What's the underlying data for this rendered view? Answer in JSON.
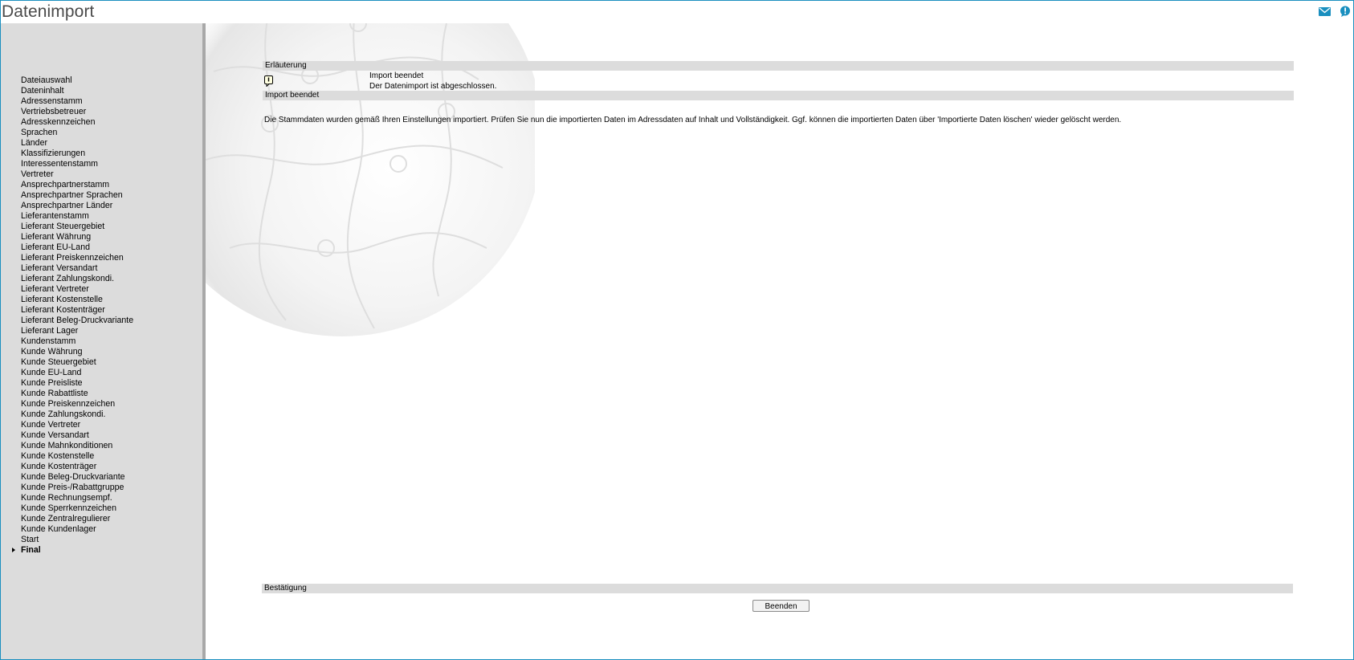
{
  "app": {
    "title": "Datenimport",
    "icons": {
      "mail": "mail-icon",
      "help": "help-icon"
    },
    "accent_color": "#1a8fbf"
  },
  "sidebar": {
    "items": [
      {
        "label": "Dateiauswahl"
      },
      {
        "label": "Dateninhalt"
      },
      {
        "label": "Adressenstamm"
      },
      {
        "label": "Vertriebsbetreuer"
      },
      {
        "label": "Adresskennzeichen"
      },
      {
        "label": "Sprachen"
      },
      {
        "label": "Länder"
      },
      {
        "label": "Klassifizierungen"
      },
      {
        "label": "Interessentenstamm"
      },
      {
        "label": "Vertreter"
      },
      {
        "label": "Ansprechpartnerstamm"
      },
      {
        "label": "Ansprechpartner Sprachen"
      },
      {
        "label": "Ansprechpartner Länder"
      },
      {
        "label": "Lieferantenstamm"
      },
      {
        "label": "Lieferant Steuergebiet"
      },
      {
        "label": "Lieferant Währung"
      },
      {
        "label": "Lieferant EU-Land"
      },
      {
        "label": "Lieferant Preiskennzeichen"
      },
      {
        "label": "Lieferant Versandart"
      },
      {
        "label": "Lieferant Zahlungskondi."
      },
      {
        "label": "Lieferant Vertreter"
      },
      {
        "label": "Lieferant Kostenstelle"
      },
      {
        "label": "Lieferant Kostenträger"
      },
      {
        "label": "Lieferant Beleg-Druckvariante"
      },
      {
        "label": "Lieferant Lager"
      },
      {
        "label": "Kundenstamm"
      },
      {
        "label": "Kunde Währung"
      },
      {
        "label": "Kunde Steuergebiet"
      },
      {
        "label": "Kunde EU-Land"
      },
      {
        "label": "Kunde Preisliste"
      },
      {
        "label": "Kunde Rabattliste"
      },
      {
        "label": "Kunde Preiskennzeichen"
      },
      {
        "label": "Kunde Zahlungskondi."
      },
      {
        "label": "Kunde Vertreter"
      },
      {
        "label": "Kunde Versandart"
      },
      {
        "label": "Kunde Mahnkonditionen"
      },
      {
        "label": "Kunde Kostenstelle"
      },
      {
        "label": "Kunde Kostenträger"
      },
      {
        "label": "Kunde Beleg-Druckvariante"
      },
      {
        "label": "Kunde Preis-/Rabattgruppe"
      },
      {
        "label": "Kunde Rechnungsempf."
      },
      {
        "label": "Kunde Sperrkennzeichen"
      },
      {
        "label": "Kunde Zentralregulierer"
      },
      {
        "label": "Kunde Kundenlager"
      },
      {
        "label": "Start"
      },
      {
        "label": "Final",
        "active": true
      }
    ]
  },
  "main": {
    "explanation": {
      "header": "Erläuterung",
      "icon": "info-icon",
      "title": "Import beendet",
      "message": "Der Datenimport ist abgeschlossen."
    },
    "status_section": {
      "header": "Import beendet",
      "text": "Die Stammdaten wurden gemäß Ihren Einstellungen importiert. Prüfen Sie nun die importierten Daten im Adressdaten auf Inhalt und Vollständigkeit. Ggf. können die importierten Daten über 'Importierte Daten löschen' wieder gelöscht werden."
    },
    "confirmation": {
      "header": "Bestätigung",
      "button_label": "Beenden"
    }
  }
}
